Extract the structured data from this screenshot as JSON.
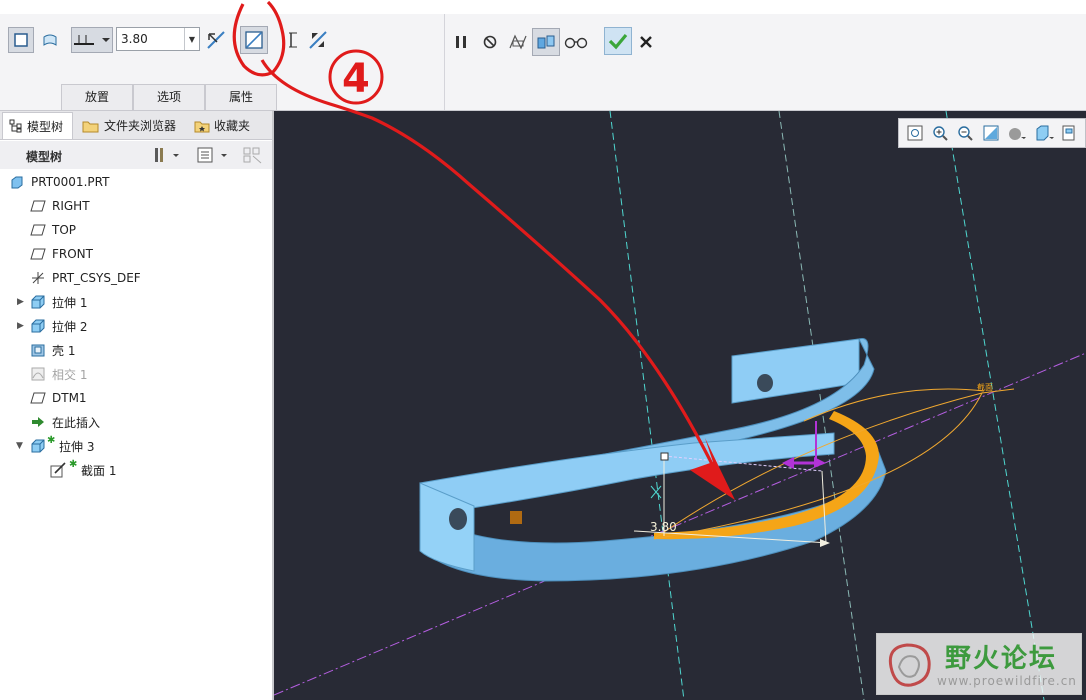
{
  "ribbon": {
    "depth_value": "3.80",
    "subtabs": [
      "放置",
      "选项",
      "属性"
    ]
  },
  "navigator": {
    "tabs": [
      "模型树",
      "文件夹浏览器",
      "收藏夹"
    ],
    "tree_title": "模型树"
  },
  "model_tree": [
    {
      "label": "PRT0001.PRT",
      "icon": "part-icon"
    },
    {
      "label": "RIGHT",
      "icon": "datum-plane-icon"
    },
    {
      "label": "TOP",
      "icon": "datum-plane-icon"
    },
    {
      "label": "FRONT",
      "icon": "datum-plane-icon"
    },
    {
      "label": "PRT_CSYS_DEF",
      "icon": "csys-icon"
    },
    {
      "label": "拉伸 1",
      "icon": "extrude-icon"
    },
    {
      "label": "拉伸 2",
      "icon": "extrude-icon"
    },
    {
      "label": "壳 1",
      "icon": "shell-icon"
    },
    {
      "label": "相交 1",
      "icon": "intersect-icon"
    },
    {
      "label": "DTM1",
      "icon": "datum-plane-icon"
    },
    {
      "label": "在此插入",
      "icon": "insert-here-icon"
    },
    {
      "label": "拉伸 3",
      "icon": "extrude-icon"
    },
    {
      "label": "截面 1",
      "icon": "sketch-icon"
    }
  ],
  "viewport": {
    "dimension_value": "3.80",
    "section_label": "截面"
  },
  "annotation": {
    "number": "4",
    "color": "#e01b1b"
  },
  "watermark": {
    "title": "野火论坛",
    "url": "www.proewildfire.cn"
  },
  "colors": {
    "viewport_bg": "#282a35",
    "part": "#8fcdf5",
    "section": "#f5a517",
    "confirm": "#3aa63a"
  }
}
